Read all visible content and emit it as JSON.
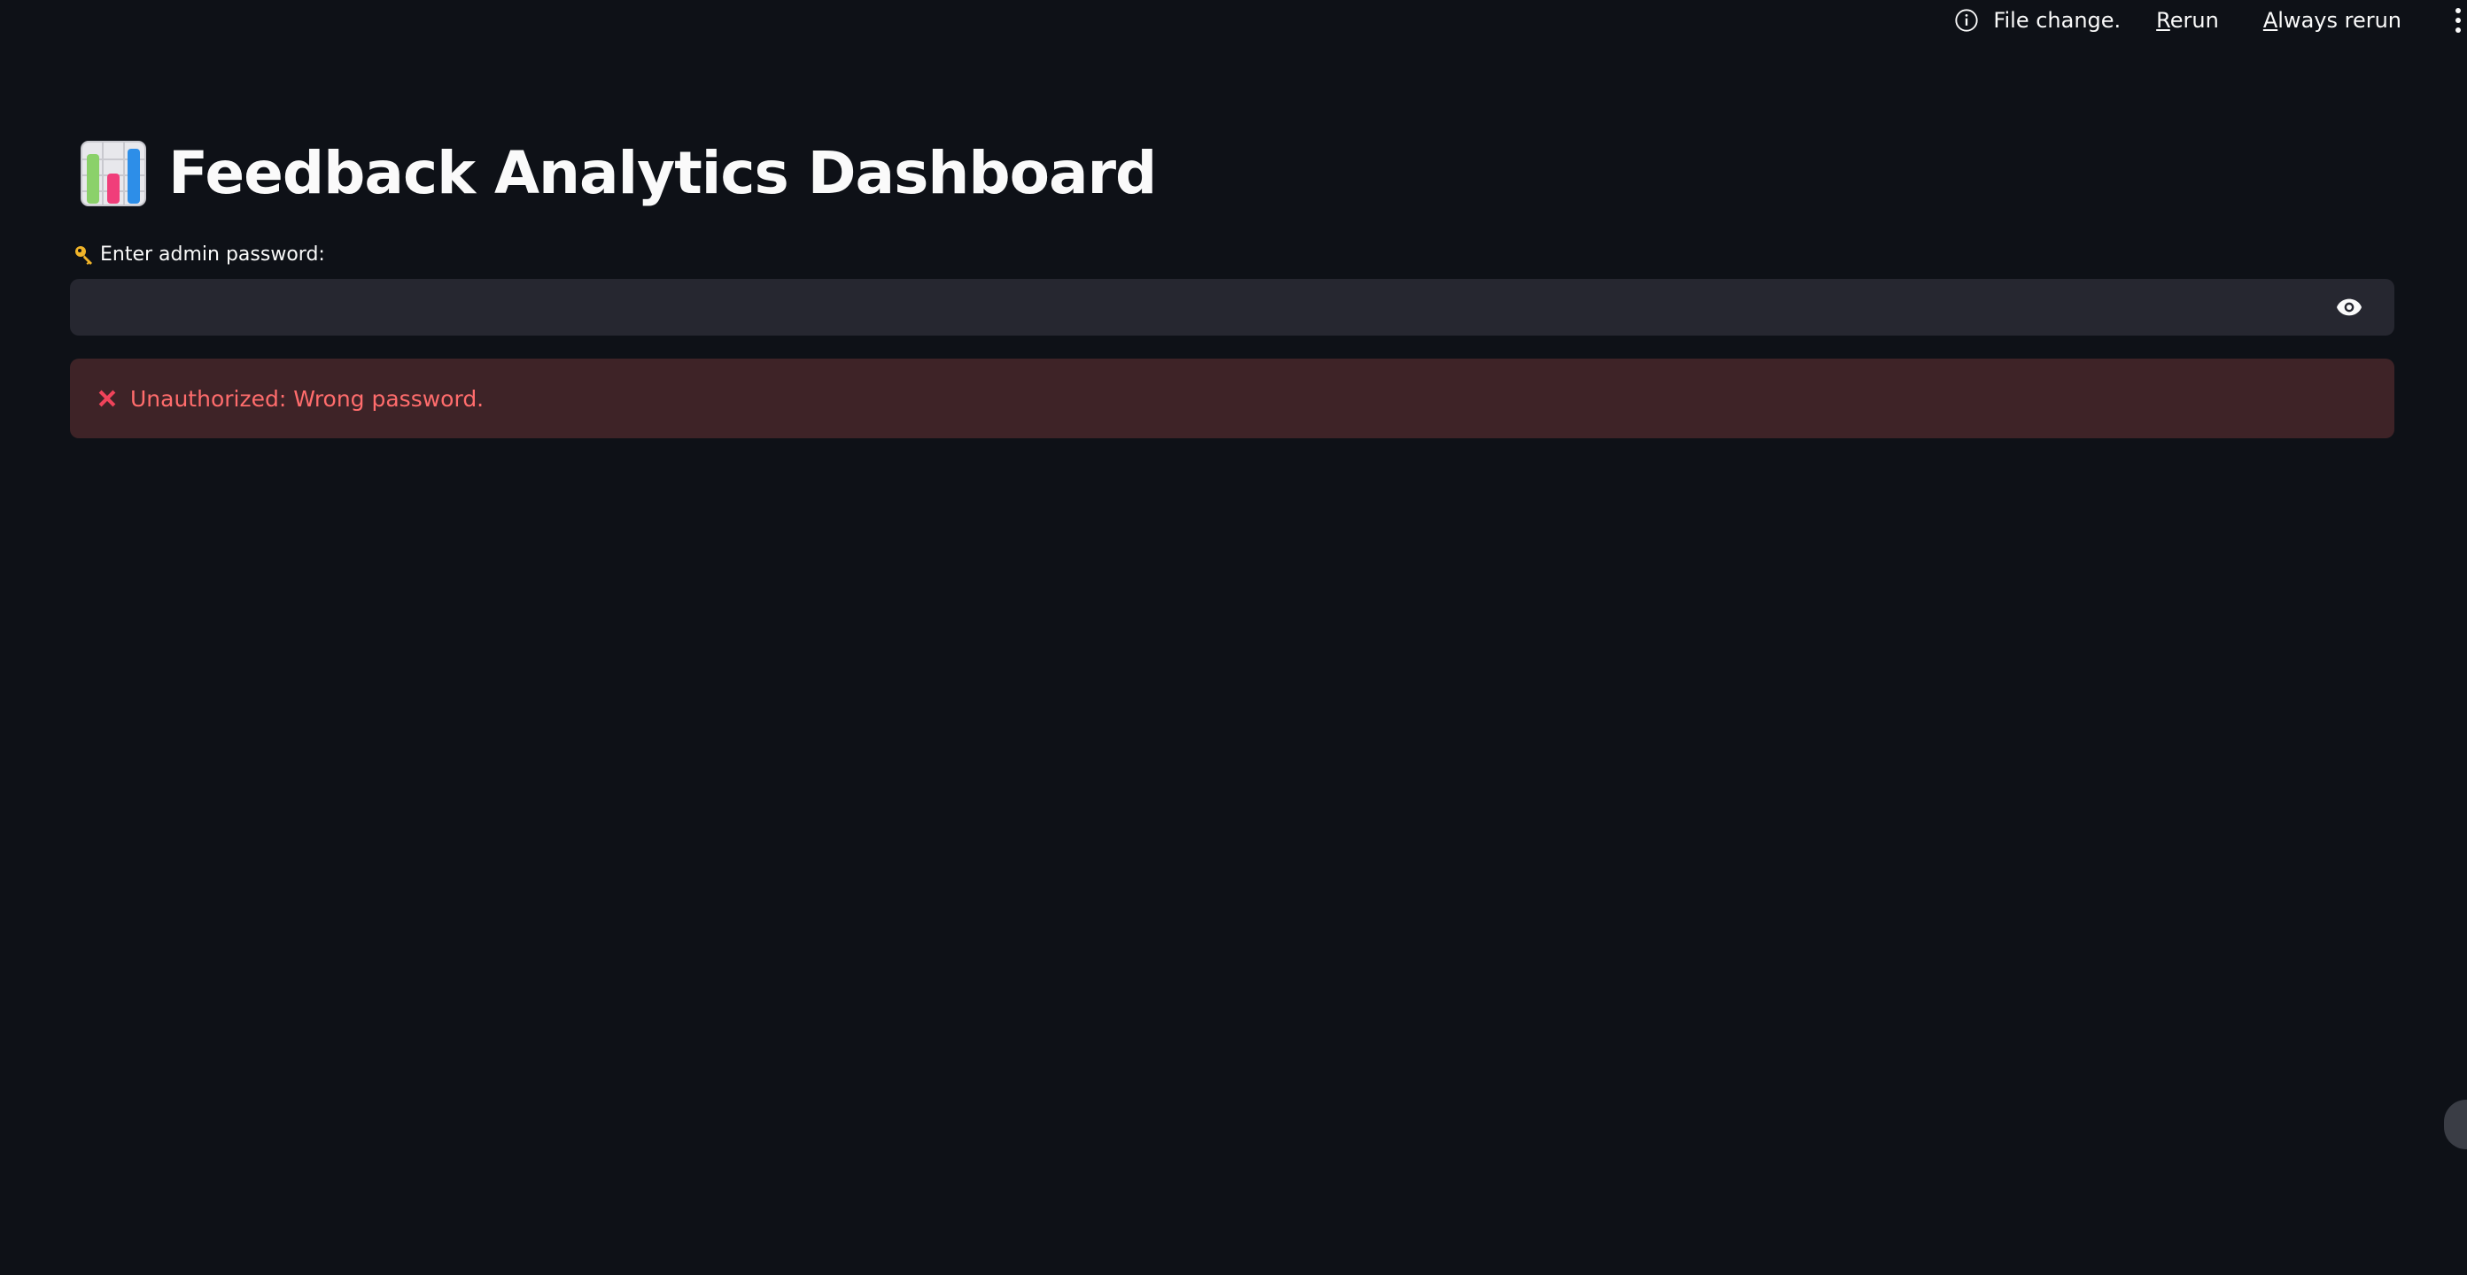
{
  "toolbar": {
    "status_text": "File change.",
    "rerun_hotkey": "R",
    "rerun_rest": "erun",
    "always_hotkey": "A",
    "always_rest": "lways rerun",
    "info_icon": "info-circle-icon",
    "menu_icon": "kebab-menu-icon"
  },
  "header": {
    "title": "Feedback Analytics Dashboard",
    "title_icon": "bar-chart-emoji-icon"
  },
  "password": {
    "label": "Enter admin password:",
    "label_icon": "key-icon",
    "value": "",
    "placeholder": "",
    "toggle_icon": "eye-icon"
  },
  "error": {
    "icon": "x-icon",
    "message": "Unauthorized: Wrong password."
  },
  "colors": {
    "background": "#0e1117",
    "input_bg": "#262730",
    "error_bg": "#3e2327",
    "error_text": "#ff6c6c",
    "text": "#fafafa"
  }
}
